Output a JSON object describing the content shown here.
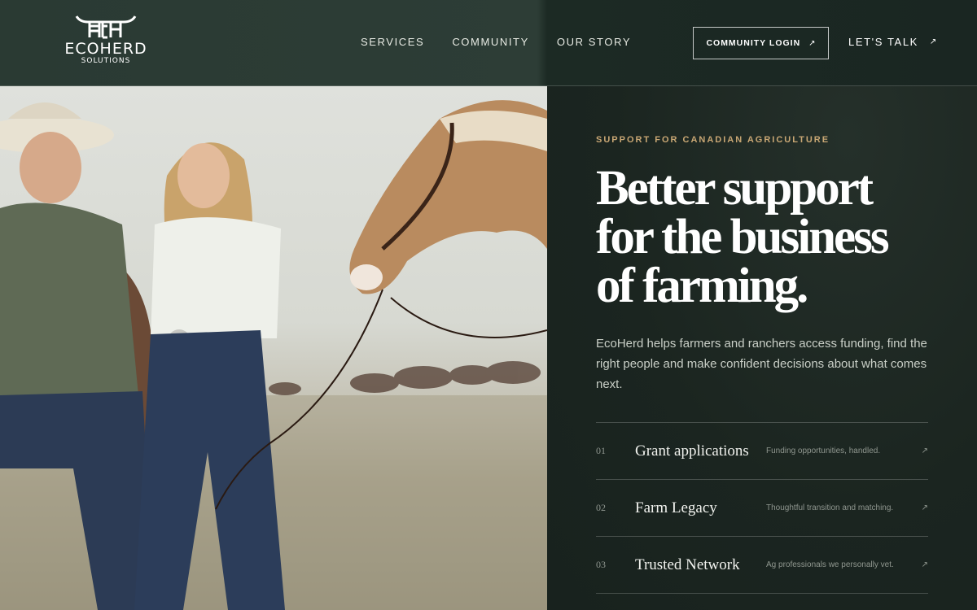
{
  "brand": {
    "name": "ECOHERD",
    "tagline": "SOLUTIONS",
    "logo_icon": "horns-monogram-icon"
  },
  "nav": {
    "items": [
      "SERVICES",
      "COMMUNITY",
      "OUR STORY"
    ]
  },
  "actions": {
    "login_label": "COMMUNITY LOGIN",
    "talk_label": "LET'S TALK",
    "arrow_glyph": "↗"
  },
  "hero": {
    "eyebrow": "SUPPORT FOR CANADIAN AGRICULTURE",
    "headline_lines": [
      "Better support",
      "for the business",
      "of farming."
    ],
    "intro": "EcoHerd helps farmers and ranchers access funding, find the right people and make confident decisions about what comes next."
  },
  "services": [
    {
      "num": "01",
      "title": "Grant applications",
      "desc": "Funding opportunities, handled."
    },
    {
      "num": "02",
      "title": "Farm Legacy",
      "desc": "Thoughtful transition and matching."
    },
    {
      "num": "03",
      "title": "Trusted Network",
      "desc": "Ag professionals we personally vet."
    }
  ],
  "colors": {
    "accent": "#c9a774",
    "panel_bg": "#18221e",
    "header_bg": "#2d3d36"
  }
}
